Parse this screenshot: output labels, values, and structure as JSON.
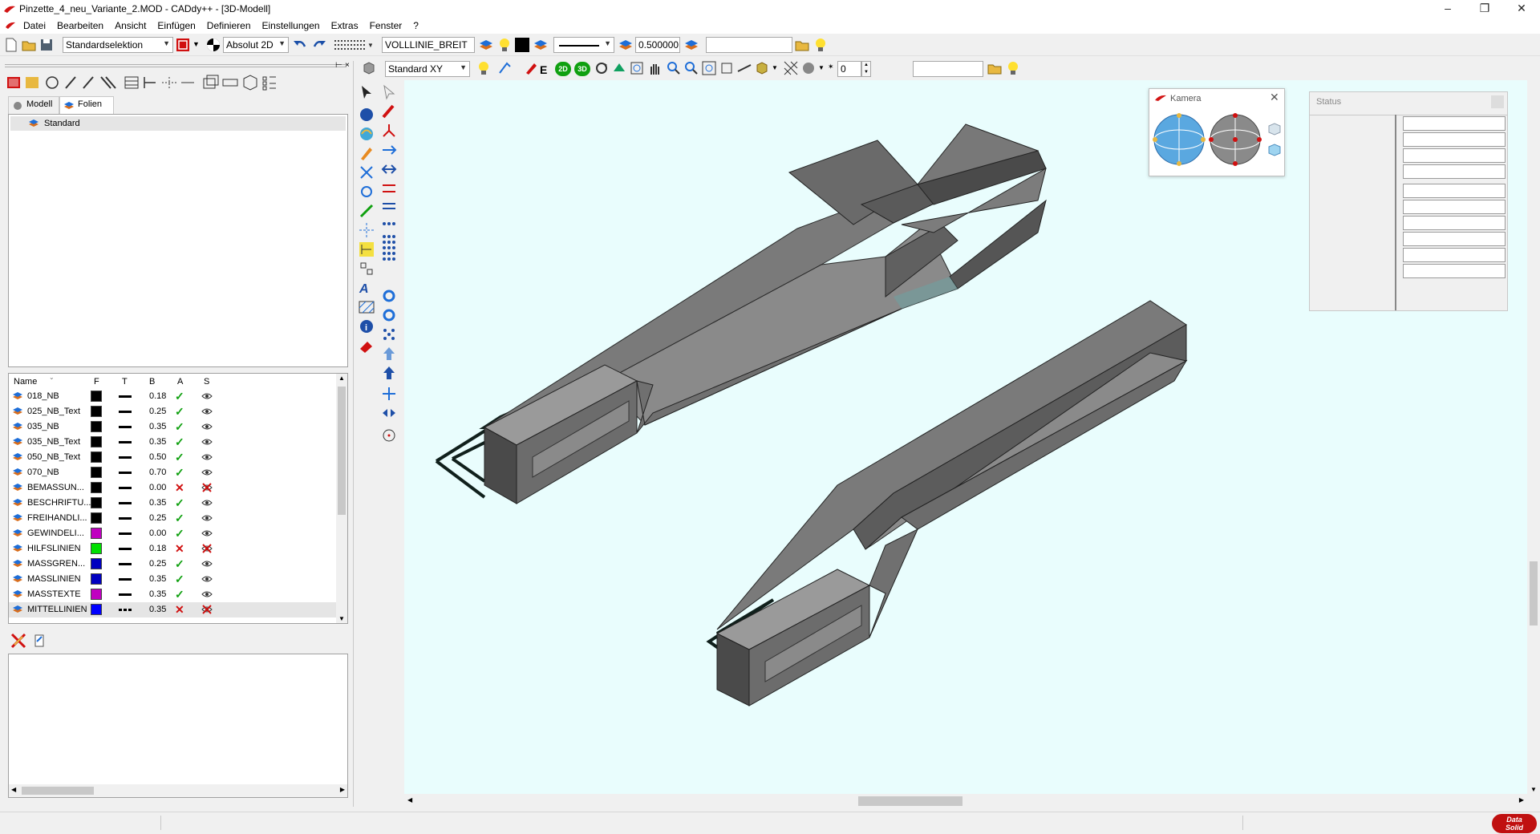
{
  "window": {
    "title": "Pinzette_4_neu_Variante_2.MOD  -  CADdy++ - [3D-Modell]",
    "controls": {
      "minimize": "–",
      "restore": "❐",
      "close": "✕"
    }
  },
  "menu": [
    "Datei",
    "Bearbeiten",
    "Ansicht",
    "Einfügen",
    "Definieren",
    "Einstellungen",
    "Extras",
    "Fenster",
    "?"
  ],
  "toolbar1": {
    "selection_mode": "Standardselektion",
    "coord_mode": "Absolut 2D",
    "linetype": "VOLLLINIE_BREIT",
    "linewidth": "0.500000",
    "search_value": ""
  },
  "toolbar2": {
    "view": "Standard XY",
    "btn_2d": "2D",
    "btn_3d": "3D",
    "number_value": "0",
    "search_value": ""
  },
  "left_panel": {
    "tabs": [
      "Modell",
      "Folien"
    ],
    "active_tab": "Folien",
    "folien": [
      "Standard"
    ],
    "layer_columns": [
      "Name",
      "F",
      "T",
      "B",
      "A",
      "S"
    ],
    "layers": [
      {
        "name": "018_NB",
        "color": "#000000",
        "line": "solid",
        "b": "0.18",
        "active": true,
        "visible": true
      },
      {
        "name": "025_NB_Text",
        "color": "#000000",
        "line": "solid",
        "b": "0.25",
        "active": true,
        "visible": true
      },
      {
        "name": "035_NB",
        "color": "#000000",
        "line": "solid",
        "b": "0.35",
        "active": true,
        "visible": true
      },
      {
        "name": "035_NB_Text",
        "color": "#000000",
        "line": "solid",
        "b": "0.35",
        "active": true,
        "visible": true
      },
      {
        "name": "050_NB_Text",
        "color": "#000000",
        "line": "solid",
        "b": "0.50",
        "active": true,
        "visible": true
      },
      {
        "name": "070_NB",
        "color": "#000000",
        "line": "solid",
        "b": "0.70",
        "active": true,
        "visible": true
      },
      {
        "name": "BEMASSUN...",
        "color": "#000000",
        "line": "solid",
        "b": "0.00",
        "active": false,
        "visible": false
      },
      {
        "name": "BESCHRIFTU...",
        "color": "#000000",
        "line": "solid",
        "b": "0.35",
        "active": true,
        "visible": true
      },
      {
        "name": "FREIHANDLI...",
        "color": "#000000",
        "line": "solid",
        "b": "0.25",
        "active": true,
        "visible": true
      },
      {
        "name": "GEWINDELI...",
        "color": "#c000c0",
        "line": "solid",
        "b": "0.00",
        "active": true,
        "visible": true
      },
      {
        "name": "HILFSLINIEN",
        "color": "#00e000",
        "line": "solid",
        "b": "0.18",
        "active": false,
        "visible": false
      },
      {
        "name": "MASSGREN...",
        "color": "#0000c0",
        "line": "solid",
        "b": "0.25",
        "active": true,
        "visible": true
      },
      {
        "name": "MASSLINIEN",
        "color": "#0000c0",
        "line": "solid",
        "b": "0.35",
        "active": true,
        "visible": true
      },
      {
        "name": "MASSTEXTE",
        "color": "#c000c0",
        "line": "solid",
        "b": "0.35",
        "active": true,
        "visible": true
      },
      {
        "name": "MITTELLINIEN",
        "color": "#0000ff",
        "line": "dashdot",
        "b": "0.35",
        "active": false,
        "visible": false
      }
    ]
  },
  "kamera": {
    "title": "Kamera"
  },
  "status_window": {
    "title": "Status"
  },
  "brand": {
    "line1": "Data",
    "line2": "Solid"
  }
}
